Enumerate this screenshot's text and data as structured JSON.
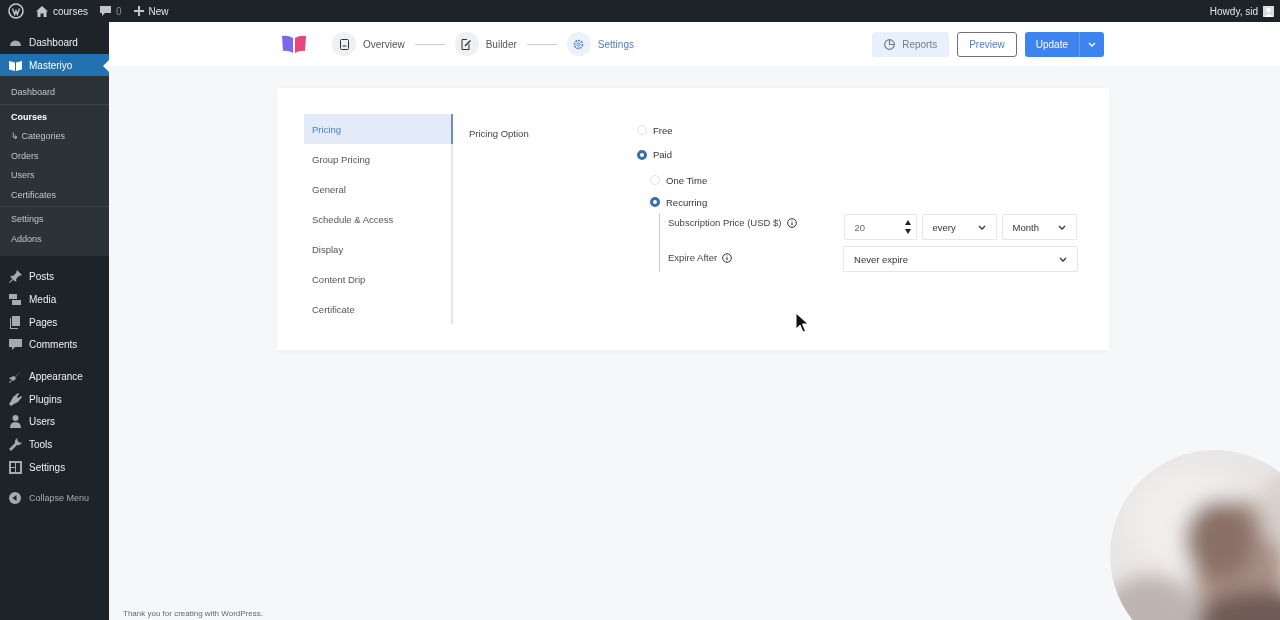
{
  "admin_bar": {
    "site": "courses",
    "comments": "0",
    "new": "New",
    "greeting": "Howdy, sid"
  },
  "sidebar": {
    "groups": [
      [
        {
          "label": "Dashboard",
          "selected": false
        },
        {
          "label": "Masteriyo",
          "selected": true
        }
      ],
      [
        {
          "label": "Posts",
          "selected": false
        },
        {
          "label": "Media",
          "selected": false
        },
        {
          "label": "Pages",
          "selected": false
        },
        {
          "label": "Comments",
          "selected": false
        }
      ],
      [
        {
          "label": "Appearance",
          "selected": false
        },
        {
          "label": "Plugins",
          "selected": false
        },
        {
          "label": "Users",
          "selected": false
        },
        {
          "label": "Tools",
          "selected": false
        },
        {
          "label": "Settings",
          "selected": false
        }
      ]
    ],
    "submenu": [
      [
        {
          "label": "Dashboard",
          "selected": false
        }
      ],
      [
        {
          "label": "Courses",
          "selected": true
        },
        {
          "label": "↳ Categories",
          "selected": false
        },
        {
          "label": "Orders",
          "selected": false
        },
        {
          "label": "Users",
          "selected": false
        },
        {
          "label": "Certificates",
          "selected": false
        }
      ],
      [
        {
          "label": "Settings",
          "selected": false
        },
        {
          "label": "Addons",
          "selected": false
        }
      ]
    ],
    "collapse": "Collapse Menu"
  },
  "header": {
    "steps": [
      {
        "label": "Overview",
        "selected": false
      },
      {
        "label": "Builder",
        "selected": false
      },
      {
        "label": "Settings",
        "selected": true
      }
    ],
    "reports": "Reports",
    "preview": "Preview",
    "update": "Update"
  },
  "settings": {
    "tabs": [
      {
        "label": "Pricing",
        "selected": true
      },
      {
        "label": "Group Pricing",
        "selected": false
      },
      {
        "label": "General",
        "selected": false
      },
      {
        "label": "Schedule & Access",
        "selected": false
      },
      {
        "label": "Display",
        "selected": false
      },
      {
        "label": "Content Drip",
        "selected": false
      },
      {
        "label": "Certificate",
        "selected": false
      }
    ],
    "pricing_option": "Pricing Option",
    "options": [
      {
        "label": "Free",
        "selected": false
      },
      {
        "label": "Paid",
        "selected": true
      }
    ],
    "payment_types": [
      {
        "label": "One Time",
        "selected": false
      },
      {
        "label": "Recurring",
        "selected": true
      }
    ],
    "subscription_price": {
      "label": "Subscription Price (USD $)",
      "value": "20",
      "interval": "every",
      "period": "Month"
    },
    "expire_after": {
      "label": "Expire After",
      "value": "Never expire"
    }
  },
  "footer": "Thank you for creating with WordPress."
}
